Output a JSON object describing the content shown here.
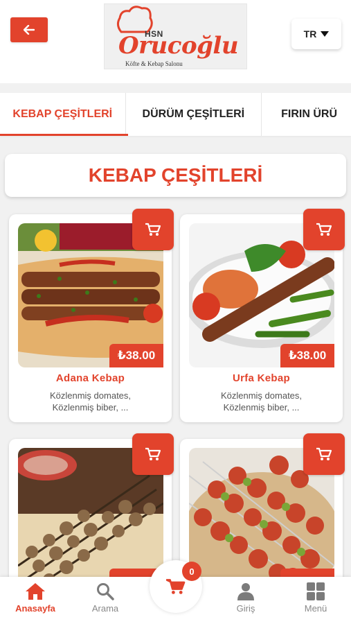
{
  "header": {
    "logo": {
      "hsn": "HSN",
      "brand": "Orucoğlu",
      "subtitle": "Köfte & Kebap Salonu"
    },
    "language": "TR"
  },
  "tabs": [
    {
      "label": "KEBAP ÇEŞİTLERİ",
      "active": true
    },
    {
      "label": "DÜRÜM ÇEŞİTLERİ",
      "active": false
    },
    {
      "label": "FIRIN ÜRÜ",
      "active": false
    }
  ],
  "section_title": "KEBAP ÇEŞİTLERİ",
  "products": [
    {
      "name": "Adana Kebap",
      "price": "₺38.00",
      "desc_line1": "Közlenmiş domates,",
      "desc_line2": "Közlenmiş biber, ..."
    },
    {
      "name": "Urfa Kebap",
      "price": "₺38.00",
      "desc_line1": "Közlenmiş domates,",
      "desc_line2": "Közlenmiş biber, ..."
    },
    {
      "name": "",
      "price": "",
      "desc_line1": "",
      "desc_line2": ""
    },
    {
      "name": "",
      "price": "",
      "desc_line1": "",
      "desc_line2": ""
    }
  ],
  "bottom_nav": {
    "home": "Anasayfa",
    "search": "Arama",
    "cart_count": "0",
    "login": "Giriş",
    "menu": "Menü"
  },
  "colors": {
    "accent": "#e2432c",
    "background": "#f1f1f1",
    "card": "#ffffff"
  },
  "icons": [
    "arrow-left-icon",
    "caret-down-icon",
    "cart-icon",
    "home-icon",
    "search-icon",
    "user-icon",
    "grid-icon",
    "chef-hat-icon"
  ]
}
